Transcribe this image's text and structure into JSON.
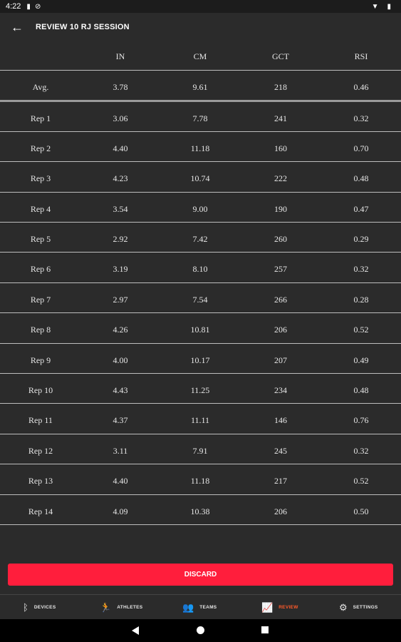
{
  "status_bar": {
    "time": "4:22"
  },
  "app_bar": {
    "title": "REVIEW 10 RJ SESSION"
  },
  "table": {
    "columns": [
      "",
      "IN",
      "CM",
      "GCT",
      "RSI"
    ],
    "average": {
      "label": "Avg.",
      "in": "3.78",
      "cm": "9.61",
      "gct": "218",
      "rsi": "0.46"
    },
    "rows": [
      {
        "label": "Rep 1",
        "in": "3.06",
        "cm": "7.78",
        "gct": "241",
        "rsi": "0.32"
      },
      {
        "label": "Rep 2",
        "in": "4.40",
        "cm": "11.18",
        "gct": "160",
        "rsi": "0.70"
      },
      {
        "label": "Rep 3",
        "in": "4.23",
        "cm": "10.74",
        "gct": "222",
        "rsi": "0.48"
      },
      {
        "label": "Rep 4",
        "in": "3.54",
        "cm": "9.00",
        "gct": "190",
        "rsi": "0.47"
      },
      {
        "label": "Rep 5",
        "in": "2.92",
        "cm": "7.42",
        "gct": "260",
        "rsi": "0.29"
      },
      {
        "label": "Rep 6",
        "in": "3.19",
        "cm": "8.10",
        "gct": "257",
        "rsi": "0.32"
      },
      {
        "label": "Rep 7",
        "in": "2.97",
        "cm": "7.54",
        "gct": "266",
        "rsi": "0.28"
      },
      {
        "label": "Rep 8",
        "in": "4.26",
        "cm": "10.81",
        "gct": "206",
        "rsi": "0.52"
      },
      {
        "label": "Rep 9",
        "in": "4.00",
        "cm": "10.17",
        "gct": "207",
        "rsi": "0.49"
      },
      {
        "label": "Rep 10",
        "in": "4.43",
        "cm": "11.25",
        "gct": "234",
        "rsi": "0.48"
      },
      {
        "label": "Rep 11",
        "in": "4.37",
        "cm": "11.11",
        "gct": "146",
        "rsi": "0.76"
      },
      {
        "label": "Rep 12",
        "in": "3.11",
        "cm": "7.91",
        "gct": "245",
        "rsi": "0.32"
      },
      {
        "label": "Rep 13",
        "in": "4.40",
        "cm": "11.18",
        "gct": "217",
        "rsi": "0.52"
      },
      {
        "label": "Rep 14",
        "in": "4.09",
        "cm": "10.38",
        "gct": "206",
        "rsi": "0.50"
      }
    ]
  },
  "discard_label": "DISCARD",
  "bottom_nav": [
    {
      "label": "DEVICES",
      "icon": "bluetooth-icon",
      "active": false
    },
    {
      "label": "ATHLETES",
      "icon": "runner-icon",
      "active": false
    },
    {
      "label": "TEAMS",
      "icon": "group-icon",
      "active": false
    },
    {
      "label": "REVIEW",
      "icon": "trending-icon",
      "active": true
    },
    {
      "label": "SETTINGS",
      "icon": "gears-icon",
      "active": false
    }
  ],
  "colors": {
    "accent": "#ff1e3c",
    "active_nav": "#ff5a2a",
    "background": "#2b2b2b"
  }
}
